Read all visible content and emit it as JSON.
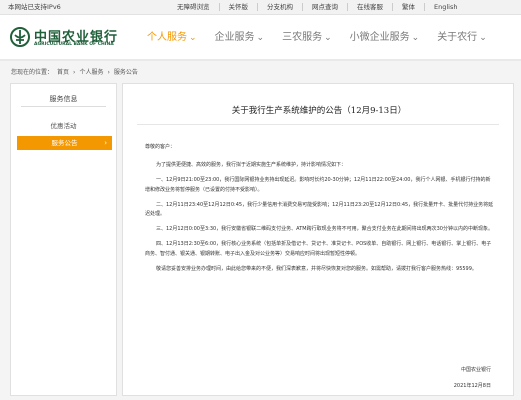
{
  "topbar": {
    "ipv6": "本网站已支持IPv6",
    "links": [
      "无障碍浏览",
      "关怀版",
      "分支机构",
      "网点查询",
      "在线客服",
      "繁体",
      "English"
    ]
  },
  "brand": {
    "name_cn": "中国农业银行",
    "name_en": "AGRICULTURAL BANK OF CHINA",
    "color": "#1f5f3a"
  },
  "nav": {
    "items": [
      {
        "label": "个人服务",
        "active": true
      },
      {
        "label": "企业服务",
        "active": false
      },
      {
        "label": "三农服务",
        "active": false
      },
      {
        "label": "小微企业服务",
        "active": false
      },
      {
        "label": "关于农行",
        "active": false
      }
    ],
    "chevron_icon": "chevron-down-icon",
    "accent_color": "#f39800"
  },
  "breadcrumb": {
    "prefix": "您现在的位置：",
    "items": [
      "首页",
      "个人服务",
      "服务公告"
    ],
    "separator": "›"
  },
  "sidebar": {
    "title": "服务信息",
    "items": [
      "优惠活动"
    ],
    "active_item": "服务公告"
  },
  "announcement": {
    "title": "关于我行生产系统维护的公告（12月9-13日）",
    "salutation": "尊敬的客户：",
    "paragraphs": [
      "为了提供更便捷、高效的服务，我行拟于近期实施生产系统维护，持计影响情况如下：",
      "一、12月9日21:00至23:00，我行国际网银持业务持出现延迟。影响时长约20-30分钟；12月11日22:00至24:00，我行个人网银、手机银行付持的新增和修改业务将暂停服务（已设置的付持不受影响）。",
      "二、12月11日23:40至12月12日0:45，我行少量信用卡消费交易可能受影响；12月11日23:20至12月12日0:45，我行批量开卡、批量代付持业务将延迟处理。",
      "三、12月12日0:00至3:30，我行安徽省银联二维码支付业务、ATM跨行取现业务将不可用，聚合支付业务在此期间将出现两次30分钟以内的中断现象。",
      "四、12月13日2:30至6:00，我行核心业务系统（包括单折及借记卡、贷记卡、准贷记卡、POS收单、自助银行、网上银行、电话银行、掌上银行、电子商务、智付通、银关通、银期转账、电子出入金及对公业务等）交易响应时间将出现暂短性停顿。",
      "敬请您妥善安排业务办理时间，由此给您带来的不便，我们深表歉意，并将尽快恢复对您的服务。如需帮助，请拨打我行客户服务热线：95599。"
    ],
    "signature": "中国农业银行",
    "date": "2021年12月8日"
  }
}
